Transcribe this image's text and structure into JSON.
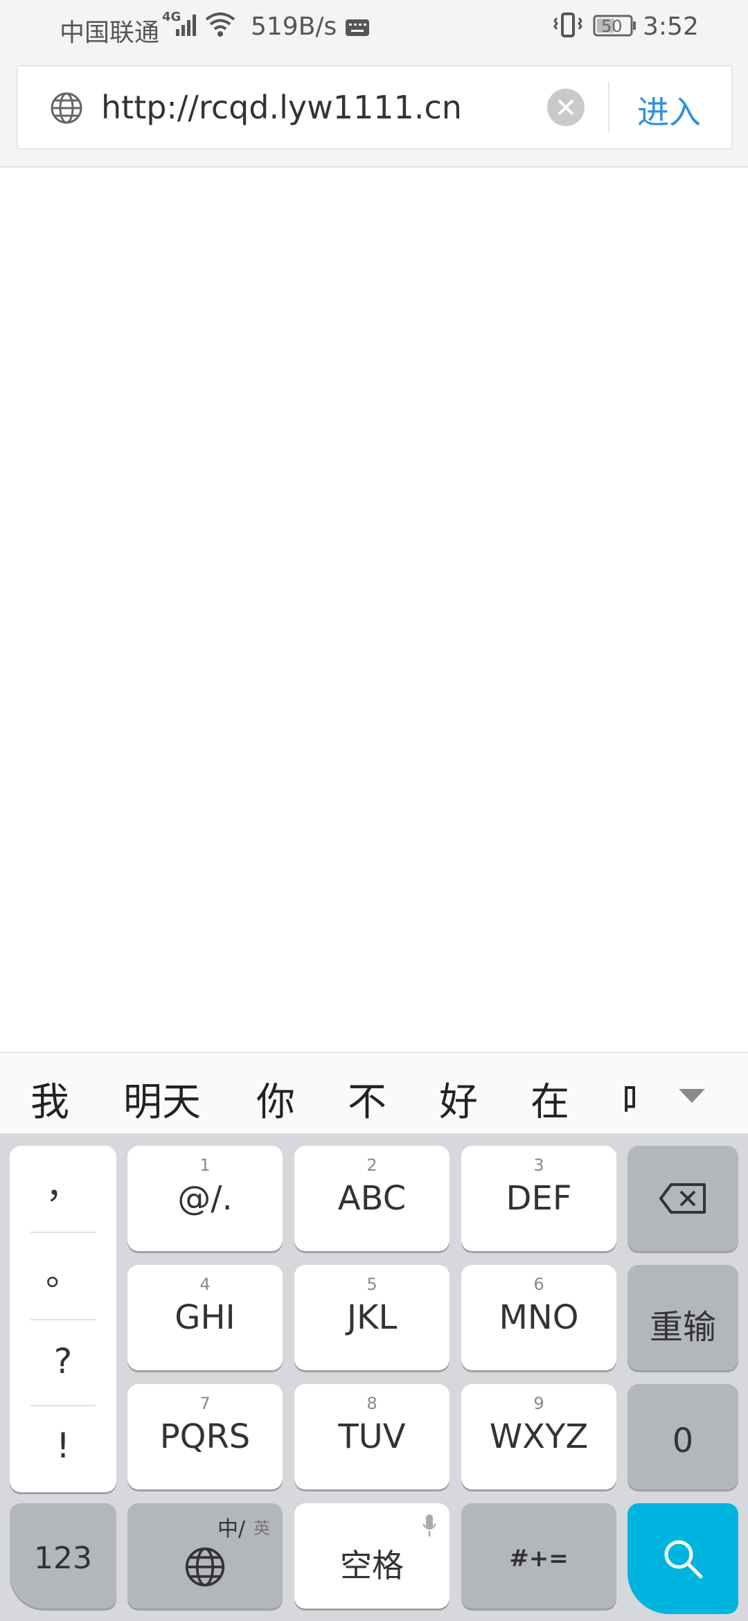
{
  "status_bar": {
    "carrier": "中国联通",
    "network_type": "4G",
    "speed": "519B/s",
    "battery": "50",
    "time": "3:52"
  },
  "url_bar": {
    "url": "http://rcqd.lyw1111.cn",
    "enter_label": "进入"
  },
  "candidates": [
    "我",
    "明天",
    "你",
    "不",
    "好",
    "在",
    "吗"
  ],
  "keyboard": {
    "punctuation": [
      "，",
      "。",
      "?",
      "!"
    ],
    "keys": [
      {
        "num": "1",
        "label": "@/."
      },
      {
        "num": "2",
        "label": "ABC"
      },
      {
        "num": "3",
        "label": "DEF"
      },
      {
        "num": "4",
        "label": "GHI"
      },
      {
        "num": "5",
        "label": "JKL"
      },
      {
        "num": "6",
        "label": "MNO"
      },
      {
        "num": "7",
        "label": "PQRS"
      },
      {
        "num": "8",
        "label": "TUV"
      },
      {
        "num": "9",
        "label": "WXYZ"
      }
    ],
    "reenter_label": "重输",
    "zero_label": "0",
    "num_label": "123",
    "lang_zh": "中/",
    "lang_en": "英",
    "space_label": "空格",
    "symbols_label": "#+=",
    "search_color": "#00b4e0"
  }
}
